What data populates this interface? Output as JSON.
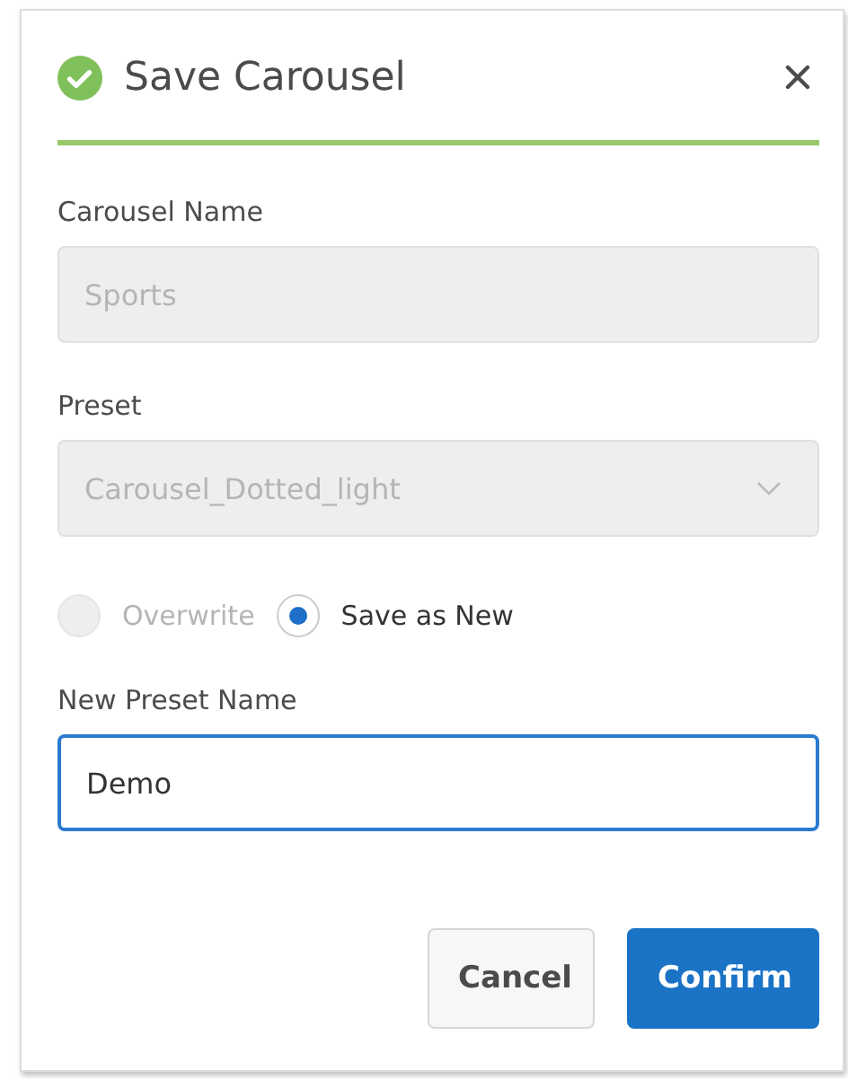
{
  "dialog": {
    "title": "Save Carousel",
    "fields": [
      {
        "kind": "text",
        "label": "Carousel Name",
        "value": "Sports",
        "disabled": true
      },
      {
        "kind": "select",
        "label": "Preset",
        "value": "Carousel_Dotted_light",
        "disabled": true
      }
    ],
    "options": [
      {
        "label": "Overwrite",
        "selected": false,
        "disabled": true
      },
      {
        "label": "Save as New",
        "selected": true,
        "disabled": false
      }
    ],
    "new_name": {
      "label": "New Preset Name",
      "value": "Demo"
    },
    "buttons": [
      {
        "kind": "secondary",
        "label": "Cancel"
      },
      {
        "kind": "primary",
        "label": "Confirm"
      }
    ]
  }
}
